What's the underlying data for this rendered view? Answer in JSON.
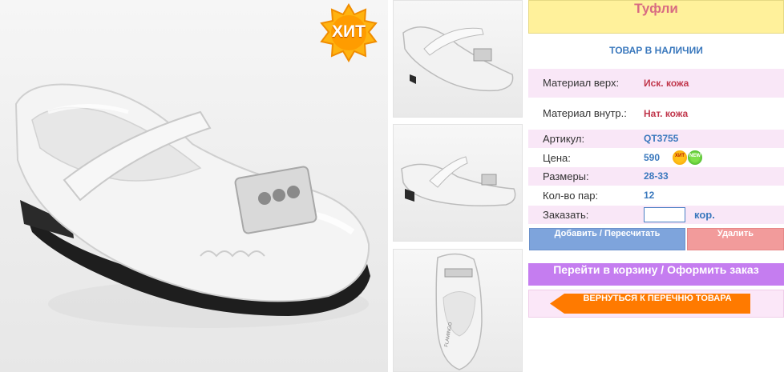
{
  "product": {
    "title": "Туфли",
    "stock_status": "ТОВАР В НАЛИЧИИ",
    "hit_badge": "ХИТ",
    "specs": [
      {
        "label": "Материал верх:",
        "value": "Иск. кожа"
      },
      {
        "label": "Материал внутр.:",
        "value": "Нат. кожа"
      },
      {
        "label": "Артикул:",
        "value": "QT3755"
      },
      {
        "label": "Цена:",
        "value": "590"
      },
      {
        "label": "Размеры:",
        "value": "28-33"
      },
      {
        "label": "Кол-во пар:",
        "value": "12"
      },
      {
        "label": "Заказать:",
        "value": ""
      }
    ],
    "price_badges": {
      "hit": "ХИТ",
      "new": "NEW"
    },
    "order": {
      "quantity": "",
      "unit": "кор."
    }
  },
  "actions": {
    "add_recalc": "Добавить / Пересчитать",
    "delete": "Удалить",
    "to_cart": "Перейти в корзину / Оформить заказ",
    "back_to_list": "ВЕРНУТЬСЯ К ПЕРЕЧНЮ ТОВАРА"
  },
  "images": {
    "thumb3_brand": "FLAMINGO"
  },
  "colors": {
    "title_bg": "#fff19b",
    "title_text": "#d86b82",
    "accent_blue": "#3a78bd",
    "accent_red": "#c0364b",
    "button_blue": "#7ea4dc",
    "button_red": "#f29b9b",
    "cart_purple": "#c57df0",
    "back_orange": "#ff7a00"
  }
}
